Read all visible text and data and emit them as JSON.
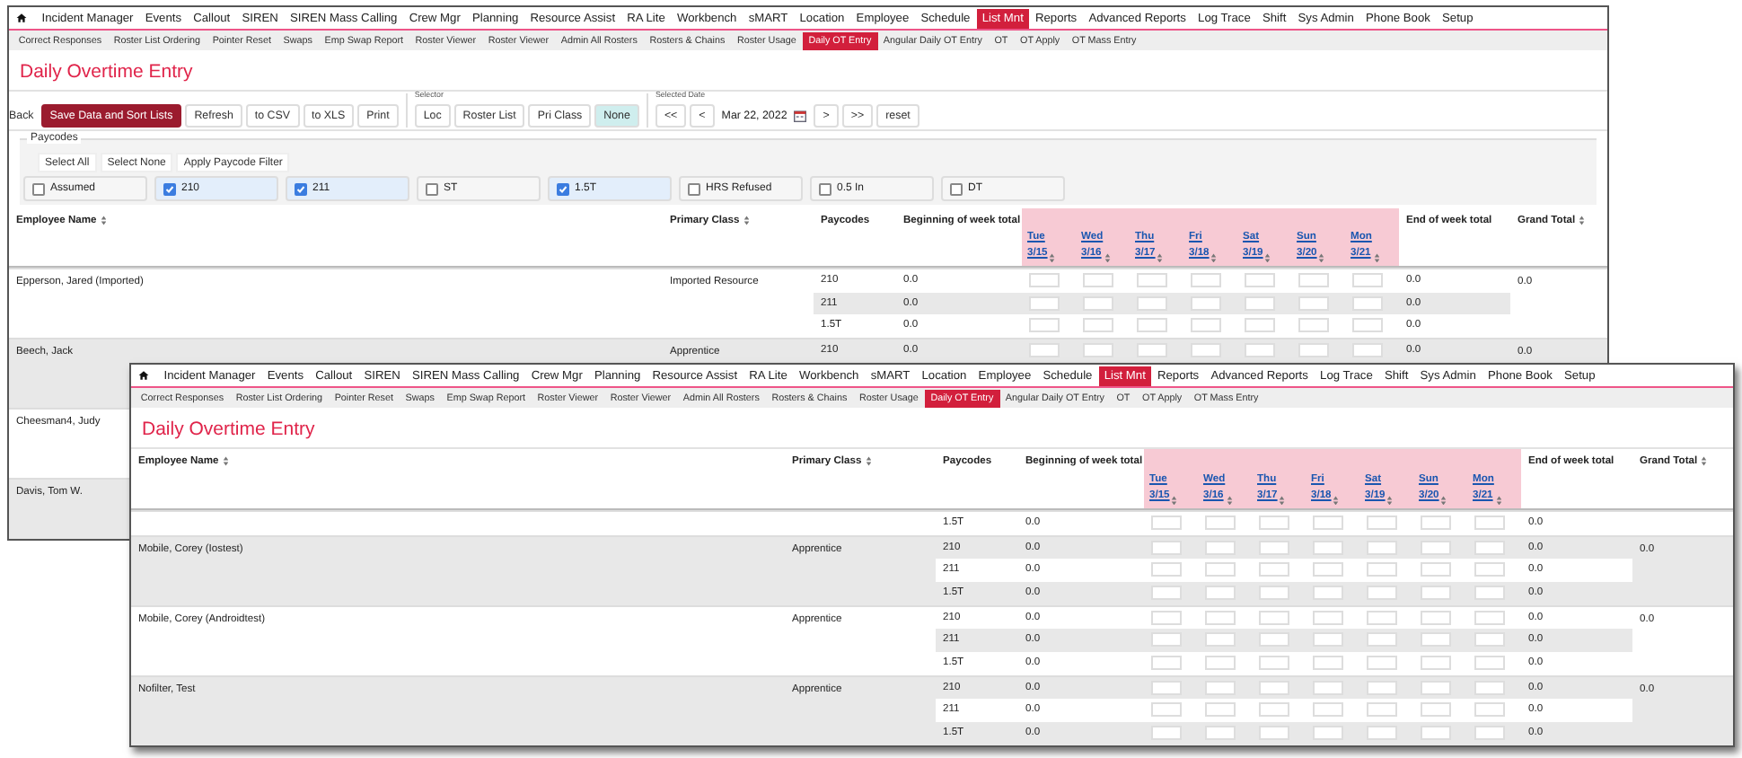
{
  "windows": [
    {
      "menu": [
        {
          "label": "Incident Manager",
          "selected": false
        },
        {
          "label": "Events",
          "selected": false
        },
        {
          "label": "Callout",
          "selected": false
        },
        {
          "label": "SIREN",
          "selected": false
        },
        {
          "label": "SIREN Mass Calling",
          "selected": false
        },
        {
          "label": "Crew Mgr",
          "selected": false
        },
        {
          "label": "Planning",
          "selected": false
        },
        {
          "label": "Resource Assist",
          "selected": false
        },
        {
          "label": "RA Lite",
          "selected": false
        },
        {
          "label": "Workbench",
          "selected": false
        },
        {
          "label": "sMART",
          "selected": false
        },
        {
          "label": "Location",
          "selected": false
        },
        {
          "label": "Employee",
          "selected": false
        },
        {
          "label": "Schedule",
          "selected": false
        },
        {
          "label": "List Mnt",
          "selected": true
        },
        {
          "label": "Reports",
          "selected": false
        },
        {
          "label": "Advanced Reports",
          "selected": false
        },
        {
          "label": "Log Trace",
          "selected": false
        },
        {
          "label": "Shift",
          "selected": false
        },
        {
          "label": "Sys Admin",
          "selected": false
        },
        {
          "label": "Phone Book",
          "selected": false
        },
        {
          "label": "Setup",
          "selected": false
        }
      ],
      "submenu": [
        {
          "label": "Correct Responses",
          "selected": false
        },
        {
          "label": "Roster List Ordering",
          "selected": false
        },
        {
          "label": "Pointer Reset",
          "selected": false
        },
        {
          "label": "Swaps",
          "selected": false
        },
        {
          "label": "Emp Swap Report",
          "selected": false
        },
        {
          "label": "Roster Viewer",
          "selected": false
        },
        {
          "label": "Roster Viewer",
          "selected": false
        },
        {
          "label": "Admin All Rosters",
          "selected": false
        },
        {
          "label": "Rosters & Chains",
          "selected": false
        },
        {
          "label": "Roster Usage",
          "selected": false
        },
        {
          "label": "Daily OT Entry",
          "selected": true
        },
        {
          "label": "Angular Daily OT Entry",
          "selected": false
        },
        {
          "label": "OT",
          "selected": false
        },
        {
          "label": "OT Apply",
          "selected": false
        },
        {
          "label": "OT Mass Entry",
          "selected": false
        }
      ],
      "title": "Daily Overtime Entry",
      "toolbar": {
        "buttons": [
          {
            "label": "Back",
            "kind": "text"
          },
          {
            "label": "Save Data and Sort Lists",
            "kind": "primary"
          },
          {
            "label": "Refresh",
            "kind": "default"
          },
          {
            "label": "to CSV",
            "kind": "default"
          },
          {
            "label": "to XLS",
            "kind": "default"
          },
          {
            "label": "Print",
            "kind": "default"
          }
        ],
        "selector": {
          "label": "Selector",
          "options": [
            {
              "label": "Loc",
              "selected": false
            },
            {
              "label": "Roster List",
              "selected": false
            },
            {
              "label": "Pri Class",
              "selected": false
            },
            {
              "label": "None",
              "selected": true
            }
          ]
        },
        "date": {
          "label": "Selected Date",
          "prev_buttons": [
            "<<",
            "<"
          ],
          "value": "Mar 22, 2022",
          "next_buttons": [
            ">",
            ">>",
            "reset"
          ]
        }
      },
      "paycodes": {
        "legend": "Paycodes",
        "actions": [
          "Select All",
          "Select None",
          "Apply Paycode Filter"
        ],
        "items": [
          {
            "label": "Assumed",
            "checked": false
          },
          {
            "label": "210",
            "checked": true
          },
          {
            "label": "211",
            "checked": true
          },
          {
            "label": "ST",
            "checked": false
          },
          {
            "label": "1.5T",
            "checked": true
          },
          {
            "label": "HRS Refused",
            "checked": false
          },
          {
            "label": "0.5 In",
            "checked": false
          },
          {
            "label": "DT",
            "checked": false
          }
        ]
      },
      "table": {
        "columns": [
          {
            "kind": "col",
            "label": "Employee Name",
            "sortable": true
          },
          {
            "kind": "col",
            "label": "Primary Class",
            "sortable": true
          },
          {
            "kind": "col",
            "label": "Paycodes",
            "sortable": false
          },
          {
            "kind": "col",
            "label": "Beginning of week total",
            "sortable": false
          },
          {
            "kind": "days",
            "days": [
              {
                "day": "Tue",
                "date": "3/15"
              },
              {
                "day": "Wed",
                "date": "3/16"
              },
              {
                "day": "Thu",
                "date": "3/17"
              },
              {
                "day": "Fri",
                "date": "3/18"
              },
              {
                "day": "Sat",
                "date": "3/19"
              },
              {
                "day": "Sun",
                "date": "3/20"
              },
              {
                "day": "Mon",
                "date": "3/21"
              }
            ]
          },
          {
            "kind": "col",
            "label": "End of week total",
            "sortable": false
          },
          {
            "kind": "col",
            "label": "Grand Total",
            "sortable": true
          }
        ],
        "rows": [
          {
            "name": "Epperson, Jared (Imported)",
            "class": "Imported Resource",
            "grand": "0.0",
            "lines": [
              {
                "paycode": "210",
                "begin": "0.0",
                "end": "0.0"
              },
              {
                "paycode": "211",
                "begin": "0.0",
                "end": "0.0"
              },
              {
                "paycode": "1.5T",
                "begin": "0.0",
                "end": "0.0"
              }
            ]
          },
          {
            "name": "Beech, Jack",
            "class": "Apprentice",
            "grand": "0.0",
            "lines": [
              {
                "paycode": "210",
                "begin": "0.0",
                "end": "0.0"
              }
            ]
          },
          {
            "name": "Cheesman4, Judy"
          },
          {
            "name": "Davis, Tom W."
          }
        ]
      }
    },
    {
      "menu": [
        {
          "label": "Incident Manager",
          "selected": false
        },
        {
          "label": "Events",
          "selected": false
        },
        {
          "label": "Callout",
          "selected": false
        },
        {
          "label": "SIREN",
          "selected": false
        },
        {
          "label": "SIREN Mass Calling",
          "selected": false
        },
        {
          "label": "Crew Mgr",
          "selected": false
        },
        {
          "label": "Planning",
          "selected": false
        },
        {
          "label": "Resource Assist",
          "selected": false
        },
        {
          "label": "RA Lite",
          "selected": false
        },
        {
          "label": "Workbench",
          "selected": false
        },
        {
          "label": "sMART",
          "selected": false
        },
        {
          "label": "Location",
          "selected": false
        },
        {
          "label": "Employee",
          "selected": false
        },
        {
          "label": "Schedule",
          "selected": false
        },
        {
          "label": "List Mnt",
          "selected": true
        },
        {
          "label": "Reports",
          "selected": false
        },
        {
          "label": "Advanced Reports",
          "selected": false
        },
        {
          "label": "Log Trace",
          "selected": false
        },
        {
          "label": "Shift",
          "selected": false
        },
        {
          "label": "Sys Admin",
          "selected": false
        },
        {
          "label": "Phone Book",
          "selected": false
        },
        {
          "label": "Setup",
          "selected": false
        }
      ],
      "submenu": [
        {
          "label": "Correct Responses",
          "selected": false
        },
        {
          "label": "Roster List Ordering",
          "selected": false
        },
        {
          "label": "Pointer Reset",
          "selected": false
        },
        {
          "label": "Swaps",
          "selected": false
        },
        {
          "label": "Emp Swap Report",
          "selected": false
        },
        {
          "label": "Roster Viewer",
          "selected": false
        },
        {
          "label": "Roster Viewer",
          "selected": false
        },
        {
          "label": "Admin All Rosters",
          "selected": false
        },
        {
          "label": "Rosters & Chains",
          "selected": false
        },
        {
          "label": "Roster Usage",
          "selected": false
        },
        {
          "label": "Daily OT Entry",
          "selected": true
        },
        {
          "label": "Angular Daily OT Entry",
          "selected": false
        },
        {
          "label": "OT",
          "selected": false
        },
        {
          "label": "OT Apply",
          "selected": false
        },
        {
          "label": "OT Mass Entry",
          "selected": false
        }
      ],
      "title": "Daily Overtime Entry",
      "table": {
        "columns": [
          {
            "kind": "col",
            "label": "Employee Name",
            "sortable": true
          },
          {
            "kind": "col",
            "label": "Primary Class",
            "sortable": true
          },
          {
            "kind": "col",
            "label": "Paycodes",
            "sortable": false
          },
          {
            "kind": "col",
            "label": "Beginning of week total",
            "sortable": false
          },
          {
            "kind": "days",
            "days": [
              {
                "day": "Tue",
                "date": "3/15"
              },
              {
                "day": "Wed",
                "date": "3/16"
              },
              {
                "day": "Thu",
                "date": "3/17"
              },
              {
                "day": "Fri",
                "date": "3/18"
              },
              {
                "day": "Sat",
                "date": "3/19"
              },
              {
                "day": "Sun",
                "date": "3/20"
              },
              {
                "day": "Mon",
                "date": "3/21"
              }
            ]
          },
          {
            "kind": "col",
            "label": "End of week total",
            "sortable": false
          },
          {
            "kind": "col",
            "label": "Grand Total",
            "sortable": true
          }
        ],
        "rows": [
          {
            "lines": [
              {
                "paycode": "1.5T",
                "begin": "0.0",
                "end": "0.0"
              }
            ]
          },
          {
            "name": "Mobile, Corey (Iostest)",
            "class": "Apprentice",
            "grand": "0.0",
            "lines": [
              {
                "paycode": "210",
                "begin": "0.0",
                "end": "0.0"
              },
              {
                "paycode": "211",
                "begin": "0.0",
                "end": "0.0"
              },
              {
                "paycode": "1.5T",
                "begin": "0.0",
                "end": "0.0"
              }
            ]
          },
          {
            "name": "Mobile, Corey (Androidtest)",
            "class": "Apprentice",
            "grand": "0.0",
            "lines": [
              {
                "paycode": "210",
                "begin": "0.0",
                "end": "0.0"
              },
              {
                "paycode": "211",
                "begin": "0.0",
                "end": "0.0"
              },
              {
                "paycode": "1.5T",
                "begin": "0.0",
                "end": "0.0"
              }
            ]
          },
          {
            "name": "Nofilter, Test",
            "class": "Apprentice",
            "grand": "0.0",
            "lines": [
              {
                "paycode": "210",
                "begin": "0.0",
                "end": "0.0"
              },
              {
                "paycode": "211",
                "begin": "0.0",
                "end": "0.0"
              },
              {
                "paycode": "1.5T",
                "begin": "0.0",
                "end": "0.0"
              }
            ]
          }
        ]
      }
    }
  ]
}
